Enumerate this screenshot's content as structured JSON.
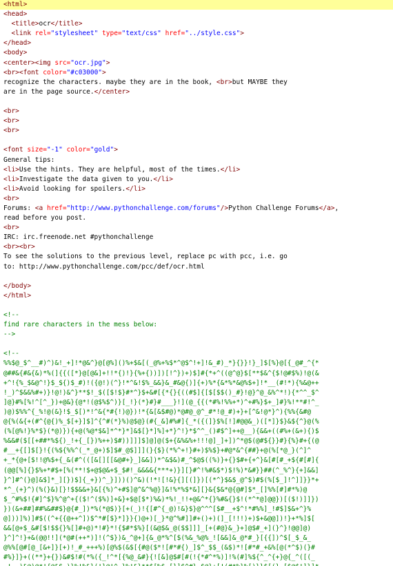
{
  "source_lines": [
    {
      "highlight": true,
      "tokens": [
        {
          "t": "tag",
          "s": "<html>"
        }
      ]
    },
    {
      "tokens": [
        {
          "t": "tag",
          "s": "<head>"
        }
      ]
    },
    {
      "tokens": [
        {
          "t": "txt",
          "s": "  "
        },
        {
          "t": "tag",
          "s": "<title>"
        },
        {
          "t": "txt",
          "s": "ocr"
        },
        {
          "t": "tag",
          "s": "</title>"
        }
      ]
    },
    {
      "tokens": [
        {
          "t": "txt",
          "s": "  "
        },
        {
          "t": "tag",
          "s": "<link "
        },
        {
          "t": "attr",
          "s": "rel="
        },
        {
          "t": "val",
          "s": "\"stylesheet\""
        },
        {
          "t": "txt",
          "s": " "
        },
        {
          "t": "attr",
          "s": "type="
        },
        {
          "t": "val",
          "s": "\"text/css\""
        },
        {
          "t": "txt",
          "s": " "
        },
        {
          "t": "attr",
          "s": "href="
        },
        {
          "t": "val",
          "s": "\"../style.css\""
        },
        {
          "t": "tag",
          "s": ">"
        }
      ]
    },
    {
      "tokens": [
        {
          "t": "tag",
          "s": "</head>"
        }
      ]
    },
    {
      "tokens": [
        {
          "t": "tag",
          "s": "<body>"
        }
      ]
    },
    {
      "tokens": [
        {
          "t": "tag",
          "s": "<center>"
        },
        {
          "t": "tag",
          "s": "<img "
        },
        {
          "t": "attr",
          "s": "src="
        },
        {
          "t": "val",
          "s": "\"ocr.jpg\""
        },
        {
          "t": "tag",
          "s": ">"
        }
      ]
    },
    {
      "tokens": [
        {
          "t": "tag",
          "s": "<br>"
        },
        {
          "t": "tag",
          "s": "<font "
        },
        {
          "t": "attr",
          "s": "color="
        },
        {
          "t": "val",
          "s": "\"#c03000\""
        },
        {
          "t": "tag",
          "s": ">"
        }
      ]
    },
    {
      "tokens": [
        {
          "t": "txt",
          "s": "recognize the characters. maybe they are in the book, "
        },
        {
          "t": "tag",
          "s": "<br>"
        },
        {
          "t": "txt",
          "s": "but MAYBE they"
        }
      ]
    },
    {
      "tokens": [
        {
          "t": "txt",
          "s": "are in the page source."
        },
        {
          "t": "tag",
          "s": "</center>"
        }
      ]
    },
    {
      "tokens": []
    },
    {
      "tokens": [
        {
          "t": "tag",
          "s": "<br>"
        }
      ]
    },
    {
      "tokens": [
        {
          "t": "tag",
          "s": "<br>"
        }
      ]
    },
    {
      "tokens": [
        {
          "t": "tag",
          "s": "<br>"
        }
      ]
    },
    {
      "tokens": []
    },
    {
      "tokens": [
        {
          "t": "tag",
          "s": "<font "
        },
        {
          "t": "attr",
          "s": "size="
        },
        {
          "t": "val",
          "s": "\"-1\""
        },
        {
          "t": "txt",
          "s": " "
        },
        {
          "t": "attr",
          "s": "color="
        },
        {
          "t": "val",
          "s": "\"gold\""
        },
        {
          "t": "tag",
          "s": ">"
        }
      ]
    },
    {
      "tokens": [
        {
          "t": "txt",
          "s": "General tips:"
        }
      ]
    },
    {
      "tokens": [
        {
          "t": "tag",
          "s": "<li>"
        },
        {
          "t": "txt",
          "s": "Use the hints. They are helpful, most of the times."
        },
        {
          "t": "tag",
          "s": "</li>"
        }
      ]
    },
    {
      "tokens": [
        {
          "t": "tag",
          "s": "<li>"
        },
        {
          "t": "txt",
          "s": "Investigate the data given to you."
        },
        {
          "t": "tag",
          "s": "</li>"
        }
      ]
    },
    {
      "tokens": [
        {
          "t": "tag",
          "s": "<li>"
        },
        {
          "t": "txt",
          "s": "Avoid looking for spoilers."
        },
        {
          "t": "tag",
          "s": "</li>"
        }
      ]
    },
    {
      "tokens": [
        {
          "t": "tag",
          "s": "<br>"
        }
      ]
    },
    {
      "tokens": [
        {
          "t": "txt",
          "s": "Forums: "
        },
        {
          "t": "tag",
          "s": "<a "
        },
        {
          "t": "attr",
          "s": "href="
        },
        {
          "t": "val",
          "s": "\"http://www.pythonchallenge.com/forums\""
        },
        {
          "t": "tag",
          "s": "/>"
        },
        {
          "t": "txt",
          "s": "Python Challenge Forums"
        },
        {
          "t": "tag",
          "s": "</a>"
        },
        {
          "t": "txt",
          "s": ","
        }
      ]
    },
    {
      "tokens": [
        {
          "t": "txt",
          "s": "read before you post."
        }
      ]
    },
    {
      "tokens": [
        {
          "t": "tag",
          "s": "<br>"
        }
      ]
    },
    {
      "tokens": [
        {
          "t": "txt",
          "s": "IRC: irc.freenode.net #pythonchallenge"
        }
      ]
    },
    {
      "tokens": [
        {
          "t": "tag",
          "s": "<br>"
        },
        {
          "t": "tag",
          "s": "<br>"
        }
      ]
    },
    {
      "tokens": [
        {
          "t": "txt",
          "s": "To see the solutions to the previous level, replace pc with pcc, i.e. go"
        }
      ]
    },
    {
      "tokens": [
        {
          "t": "txt",
          "s": "to: http://www.pythonchallenge.com/pcc/def/ocr.html"
        }
      ]
    },
    {
      "tokens": []
    },
    {
      "tokens": [
        {
          "t": "tag",
          "s": "</body>"
        }
      ]
    },
    {
      "tokens": [
        {
          "t": "tag",
          "s": "</html>"
        }
      ]
    },
    {
      "tokens": []
    },
    {
      "tokens": [
        {
          "t": "cmt",
          "s": "<!--"
        }
      ]
    },
    {
      "tokens": [
        {
          "t": "cmt",
          "s": "find rare characters in the mess below:"
        }
      ]
    },
    {
      "tokens": [
        {
          "t": "cmt",
          "s": "-->"
        }
      ]
    },
    {
      "tokens": []
    },
    {
      "tokens": [
        {
          "t": "cmt",
          "s": "<!--"
        }
      ]
    },
    {
      "tokens": [
        {
          "t": "cmt",
          "s": "%%$@_$^__#)^)&!_+]!*@&^}@[@%]()%+$&[(_@%+%$*^@$^!+]!&_#)_*}{}}!}_]$[%}@[{_@#_^{*"
        }
      ]
    },
    {
      "tokens": [
        {
          "t": "cmt",
          "s": "@##&{#&{&)*%(]{{([*}@[@&]+!!*{)!}{%+{))])[!^})+)$]#{*+^((@^@}$[**$&^{$!@#$%)!@(&"
        }
      ]
    },
    {
      "tokens": [
        {
          "t": "cmt",
          "s": "+^!{%_$&@^!}$_${)$_#)!({@!)(^}!*^&!$%_&&}&_#&@{)]{+)%*{&*%*&@%$+]!*__(#!*){%&@++"
        }
      ]
    },
    {
      "tokens": [
        {
          "t": "cmt",
          "s": "!_)^$&&%#+)}!@!)&^}**$!_$([$!$}#*^}$+&#[{*{}{((#$]{[$[$$()_#}!@}^@_&%^*!){*^^_$^"
        }
      ]
    },
    {
      "tokens": [
        {
          "t": "cmt",
          "s": "]@}#%[%!^[^_})+@&}{@*!(@$%$^)}[_!}(*}#}#___}!](@_{{(*#%!%%+*)^+#%}$+_]#}%!**#!^_"
        }
      ]
    },
    {
      "tokens": [
        {
          "t": "cmt",
          "s": ")@)$%%^{_%!@(&}!$_$[)*!^&{*#{!)@})!*{&[&$#@)*@#@_@^_#*!@_#)+}+[^&!@*}^){%%{&#@"
        }
      ]
    },
    {
      "tokens": [
        {
          "t": "cmt",
          "s": "@{%(&{+(#^{@{)%_$[+}]$]^{^#(*}%)@$@}(#{_&]#%#]{_*({(]}$%[!]#@@&_)([*]}$}&${^}@(%"
        }
      ]
    },
    {
      "tokens": [
        {
          "t": "cmt",
          "s": "(%[@%!}%*$}(*@)}){+@(%@*$&]*^*}*]&$[}*]%]+*}^!}*$^^_()#$^]++@__){&&+((#%+(&+){)$"
        }
      ]
    },
    {
      "tokens": [
        {
          "t": "cmt",
          "s": "%&&#($[[+##*%${)_!+{_[})%++)$#))]]]$]@]@($+{&%&%+!!!@]_]+])^*@$(@#${}}#}{%}#+{(@"
        }
      ]
    },
    {
      "tokens": [
        {
          "t": "cmt",
          "s": "#__+{[]$[}!{(%${%%^(_*_@+)$]$#_@$]]](}{$}(*%^+!}#+)$%$}+#@*&^{##}+@(%[*@_}(^]^"
        }
      ]
    },
    {
      "tokens": [
        {
          "t": "cmt",
          "s": "+_*{@+[$!!@%$+{_&(#^(([&[][[&@#+}_]&&])*^&$&)#_^$@$((%)}+{}$#+{+^}&[#[#_+${#[#]{"
        }
      ]
    },
    {
      "tokens": [
        {
          "t": "cmt",
          "s": "(@@[%]{}$%+*#$+[%(**!$+@$@&+$_$#!_&&&&{***+)}][}#^!%#&$*)$!%)*&#}}##(^_%^}{+]&&]"
        }
      ]
    },
    {
      "tokens": [
        {
          "t": "cmt",
          "s": "}^]#^(}@]&$]*_][})$]{_+})^_}]))()^&)(!*![!&}{][(]})[(*^}$&$_@^$)#$(%[$_]!^]]}}*+"
        }
      ]
    },
    {
      "tokens": [
        {
          "t": "cmt",
          "s": "*^_(+}^)(%(}&)[}!$$&&+}&[{%)^+#$]@^&^%@}]&!%*%$*&][}&{$&*@{@#]$*_[]%%[#]#*%)@"
        }
      ]
    },
    {
      "tokens": [
        {
          "t": "cmt",
          "s": "$_^#%$!{#]^$}%^@^+{($!^($%)]+&}+$@[$*)%&)*%!_!!+@&^*{}%#&{}$!(*^*@]@@})[($!)]]})"
        }
      ]
    },
    {
      "tokens": [
        {
          "t": "cmt",
          "s": "})(&+##]##%&##$}@{#_])*%(*@$)}[+(_)!{[#^{_@)!&}$}@^^^[$#__+$^!*#%%]_!#$]$&+^}%"
        }
      ]
    },
    {
      "tokens": [
        {
          "t": "cmt",
          "s": "@]))]%)]#$((^+{{@++^])$^*#[$}*]}}{)@+)[_}*@^%#]]#+()+)(]_[!!!)+)$+&@@])!}+*%]$["
        }
      ]
    },
    {
      "tokens": [
        {
          "t": "cmt",
          "s": "&&[@+$_&#[$!$${}%[]#+@)*!#}*!{$#*$%}[(&@$&_@($$]]]_[+(#@}&_}+]@$#_+](}^}!@@]@)"
        }
      ]
    },
    {
      "tokens": [
        {
          "t": "cmt",
          "s": "}^]^!}+&(@@!!](*@#(++*)]!(^$})&_^@+]{&_@*%^[$(%&_%@%_![&&]&_@*#_}[{{])^$[_$_&_"
        }
      ]
    },
    {
      "tokens": [
        {
          "t": "cmt",
          "s": "@%%[@#[@_[&+]}[+)!_#_+++%)[@%$(&$[{#@($*![#*#{)_]$^_$$_(&$)*![#*#_+&%[@(*^$)(}#"
        }
      ]
    },
    {
      "tokens": [
        {
          "t": "cmt",
          "s": "#%}]}+((**}+{})&#$!#(*%({_!^*[{%@_&#}{![&]@$#[#(!{*#^*%)]!%(#]%${^_^{+}@{_^([(_"
        }
      ]
    },
    {
      "tokens": [
        {
          "t": "cmt",
          "s": "_!__)&@)@*!{@&$_)}%!%&}(!}@!^_}%!&}**$[%$_[}]$^#}_$@}+[!(#*%}%[)}}$[(}_[$@$!]}]*"
        }
      ]
    }
  ]
}
